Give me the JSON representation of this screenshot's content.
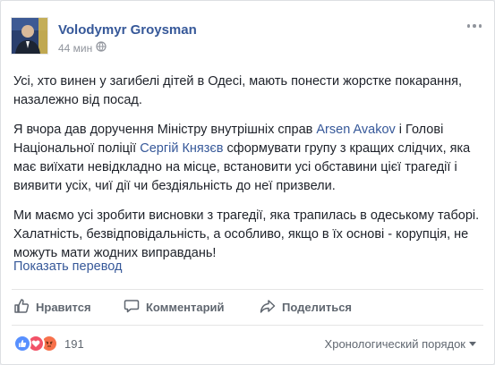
{
  "post": {
    "author": "Volodymyr Groysman",
    "time": "44 мин",
    "paragraphs": {
      "p1": "Усі, хто винен у загибелі дітей в Одесі, мають понести жорстке покарання, назалежно від посад.",
      "p2_a": "Я вчора дав доручення Міністру внутрішніх справ ",
      "p2_link1": "Arsen Avakov",
      "p2_b": " і Голові Національної поліції ",
      "p2_link2": "Сергій Князєв",
      "p2_c": " сформувати групу з кращих слідчих, яка має виїхати невідкладно на місце, встановити усі обставини цієї трагедії і виявити усіх, чиї дії чи бездіяльність до неї призвели.",
      "p3": "Ми маємо усі зробити висновки з трагедії, яка трапилась в одеському таборі. Халатність, безвідповідальність, а особливо, якщо в їх основі - корупція, не можуть мати жодних виправдань!"
    },
    "translate_link": "Показать перевод"
  },
  "actions": {
    "like": "Нравится",
    "comment": "Комментарий",
    "share": "Поделиться"
  },
  "footer": {
    "reaction_count": "191",
    "reactions": [
      "like-icon",
      "love-icon",
      "angry-icon"
    ],
    "order_label": "Хронологический порядок"
  },
  "colors": {
    "link": "#365899",
    "like": "#5890ff",
    "love": "#f25268",
    "angry": "#f7714b"
  }
}
